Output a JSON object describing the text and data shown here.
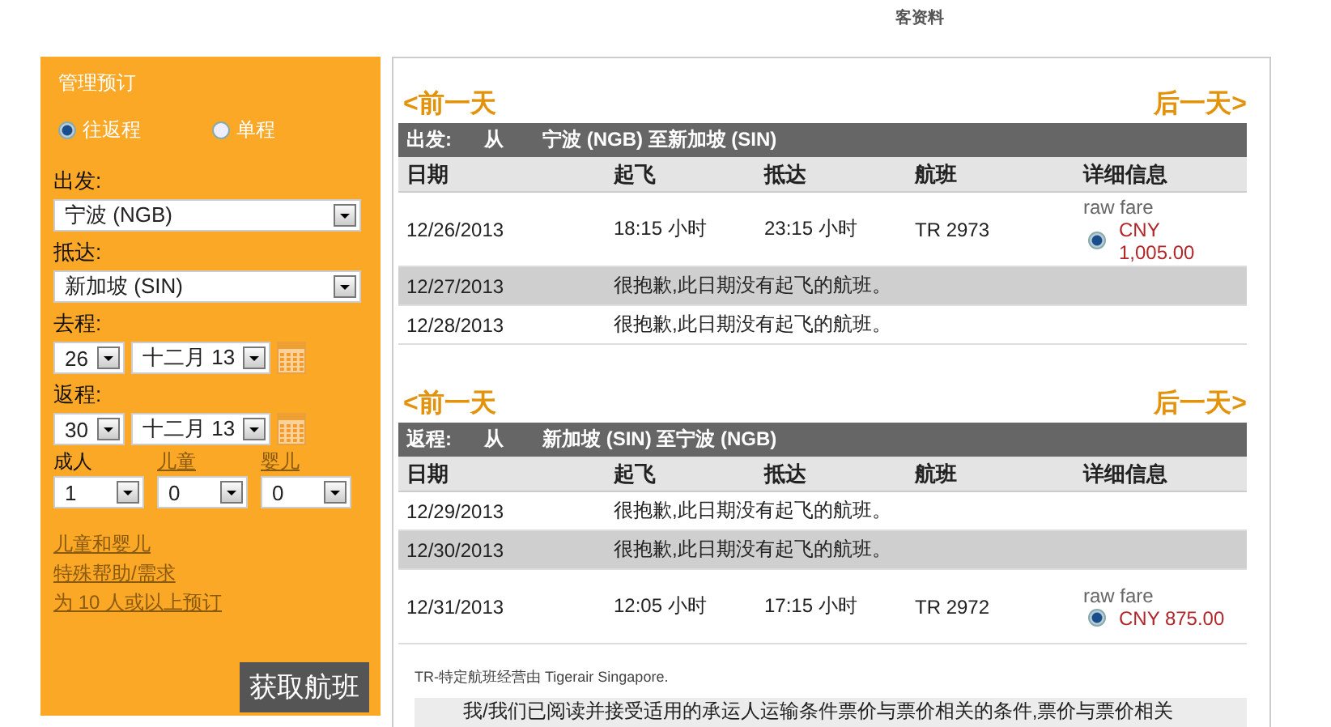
{
  "nav_fragment": "客资料",
  "sidebar": {
    "title": "管理预订",
    "trip_types": [
      {
        "label": "往返程",
        "selected": true
      },
      {
        "label": "单程",
        "selected": false
      }
    ],
    "origin": {
      "label": "出发:",
      "value": "宁波 (NGB)"
    },
    "destination": {
      "label": "抵达:",
      "value": "新加坡 (SIN)"
    },
    "depart": {
      "label": "去程:",
      "day": "26",
      "month": "十二月 13"
    },
    "return": {
      "label": "返程:",
      "day": "30",
      "month": "十二月 13"
    },
    "passengers": [
      {
        "label": "成人",
        "link": false,
        "value": "1"
      },
      {
        "label": "儿童",
        "link": true,
        "value": "0"
      },
      {
        "label": "婴儿",
        "link": true,
        "value": "0"
      }
    ],
    "links": [
      "儿童和婴儿",
      "特殊帮助/需求",
      "为 10 人或以上预订"
    ],
    "search_button": "获取航班"
  },
  "journeys": [
    {
      "prev": "<前一天",
      "next": "后一天>",
      "heading": "出发:",
      "from_word": "从",
      "route": "宁波 (NGB) 至新加坡 (SIN)",
      "columns": [
        "日期",
        "起飞",
        "抵达",
        "航班",
        "详细信息"
      ],
      "rows": [
        {
          "kind": "flight",
          "date": "12/26/2013",
          "depart": "18:15 小时",
          "arrive": "23:15 小时",
          "flight": "TR 2973",
          "fare_label": "raw fare",
          "price": "CNY 1,005.00",
          "selected": true
        },
        {
          "kind": "none",
          "date": "12/27/2013",
          "message": "很抱歉,此日期没有起飞的航班。"
        },
        {
          "kind": "none",
          "date": "12/28/2013",
          "message": "很抱歉,此日期没有起飞的航班。"
        }
      ]
    },
    {
      "prev": "<前一天",
      "next": "后一天>",
      "heading": "返程:",
      "from_word": "从",
      "route": "新加坡 (SIN) 至宁波 (NGB)",
      "columns": [
        "日期",
        "起飞",
        "抵达",
        "航班",
        "详细信息"
      ],
      "rows": [
        {
          "kind": "none",
          "date": "12/29/2013",
          "message": "很抱歉,此日期没有起飞的航班。"
        },
        {
          "kind": "none",
          "date": "12/30/2013",
          "message": "很抱歉,此日期没有起飞的航班。"
        },
        {
          "kind": "flight",
          "date": "12/31/2013",
          "depart": "12:05 小时",
          "arrive": "17:15 小时",
          "flight": "TR 2972",
          "fare_label": "raw fare",
          "price": "CNY 875.00",
          "selected": true
        }
      ]
    }
  ],
  "operator_note": "TR-特定航班经营由 Tigerair Singapore.",
  "terms_text": "我/我们已阅读并接受适用的承运人运输条件票价与票价相关的条件,票价与票价相关"
}
